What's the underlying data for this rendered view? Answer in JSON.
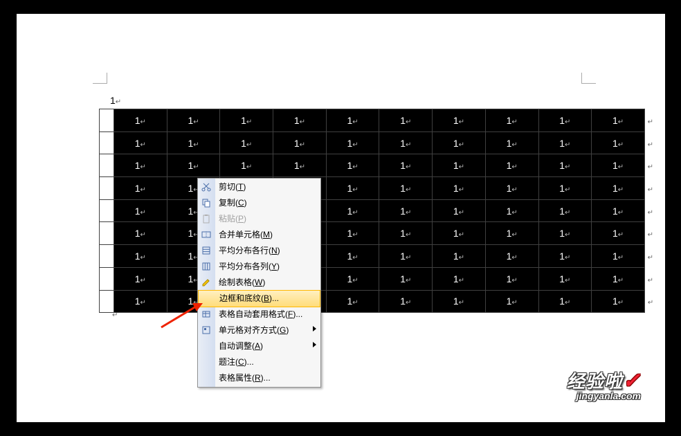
{
  "pre_text": "1",
  "post_text": "",
  "table": {
    "rows": 9,
    "cols": 11,
    "cell_value": "1"
  },
  "menu": {
    "items": [
      {
        "label_pre": "剪切(",
        "hotkey": "T",
        "label_post": ")",
        "icon": "scissors",
        "disabled": false
      },
      {
        "label_pre": "复制(",
        "hotkey": "C",
        "label_post": ")",
        "icon": "copy",
        "disabled": false
      },
      {
        "label_pre": "粘贴(",
        "hotkey": "P",
        "label_post": ")",
        "icon": "paste",
        "disabled": true
      },
      {
        "label_pre": "合并单元格(",
        "hotkey": "M",
        "label_post": ")",
        "icon": "merge",
        "disabled": false
      },
      {
        "label_pre": "平均分布各行(",
        "hotkey": "N",
        "label_post": ")",
        "icon": "distr-rows",
        "disabled": false
      },
      {
        "label_pre": "平均分布各列(",
        "hotkey": "Y",
        "label_post": ")",
        "icon": "distr-cols",
        "disabled": false
      },
      {
        "label_pre": "绘制表格(",
        "hotkey": "W",
        "label_post": ")",
        "icon": "pencil",
        "disabled": false
      },
      {
        "label_pre": "边框和底纹(",
        "hotkey": "B",
        "label_post": ")...",
        "icon": "",
        "disabled": false,
        "highlight": true
      },
      {
        "label_pre": "表格自动套用格式(",
        "hotkey": "F",
        "label_post": ")...",
        "icon": "autoformat",
        "disabled": false
      },
      {
        "label_pre": "单元格对齐方式(",
        "hotkey": "G",
        "label_post": ")",
        "icon": "align",
        "disabled": false,
        "submenu": true
      },
      {
        "label_pre": "自动调整(",
        "hotkey": "A",
        "label_post": ")",
        "icon": "",
        "disabled": false,
        "submenu": true
      },
      {
        "label_pre": "题注(",
        "hotkey": "C",
        "label_post": ")...",
        "icon": "",
        "disabled": false
      },
      {
        "label_pre": "表格属性(",
        "hotkey": "R",
        "label_post": ")...",
        "icon": "",
        "disabled": false
      }
    ]
  },
  "watermark": {
    "big": "经验啦",
    "check": "✓",
    "small": "jingyanla.com"
  },
  "colors": {
    "highlight": "#ffdc7a",
    "menu_border": "#919191"
  },
  "chart_data": null
}
